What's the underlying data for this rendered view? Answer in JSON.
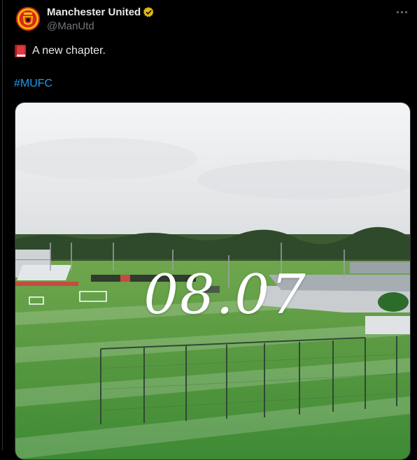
{
  "post": {
    "author_name": "Manchester United",
    "handle": "@ManUtd",
    "text": "A new chapter.",
    "hashtag": "#MUFC",
    "verified_badge_color": "#e2b719",
    "hashtag_color": "#1d9bf0"
  },
  "media": {
    "overlay_text": "08.07",
    "description_icon": "book-icon"
  }
}
